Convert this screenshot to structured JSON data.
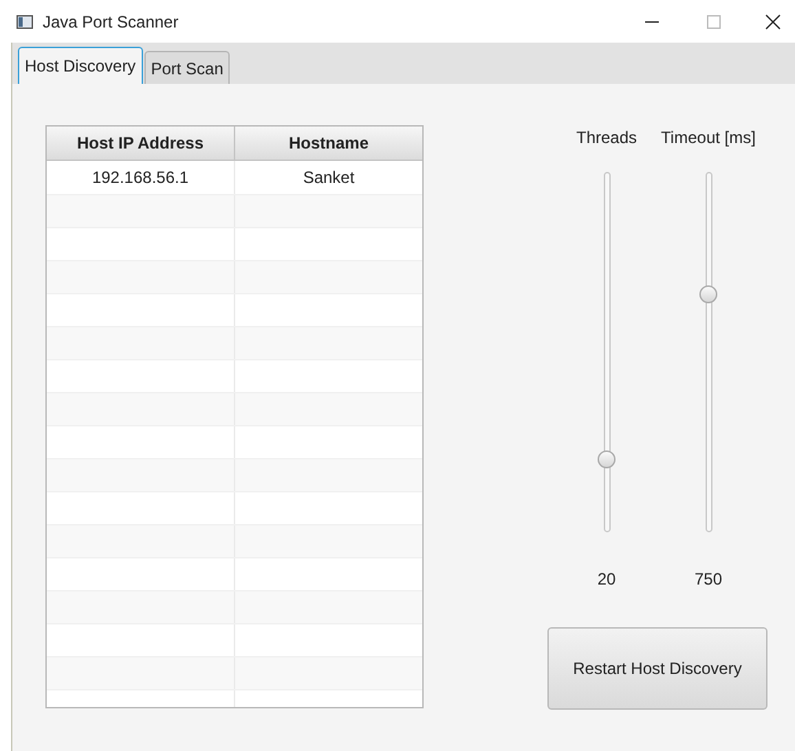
{
  "window": {
    "title": "Java Port Scanner"
  },
  "tabs": [
    {
      "label": "Host Discovery",
      "selected": true
    },
    {
      "label": "Port Scan",
      "selected": false
    }
  ],
  "table": {
    "columns": [
      "Host IP Address",
      "Hostname"
    ],
    "rows": [
      [
        "192.168.56.1",
        "Sanket"
      ]
    ]
  },
  "sliders": [
    {
      "label": "Threads",
      "level": 0.2,
      "reading": "20"
    },
    {
      "label": "Timeout [ms]",
      "level": 0.66,
      "reading": "750"
    }
  ],
  "button": "Restart Host Discovery"
}
